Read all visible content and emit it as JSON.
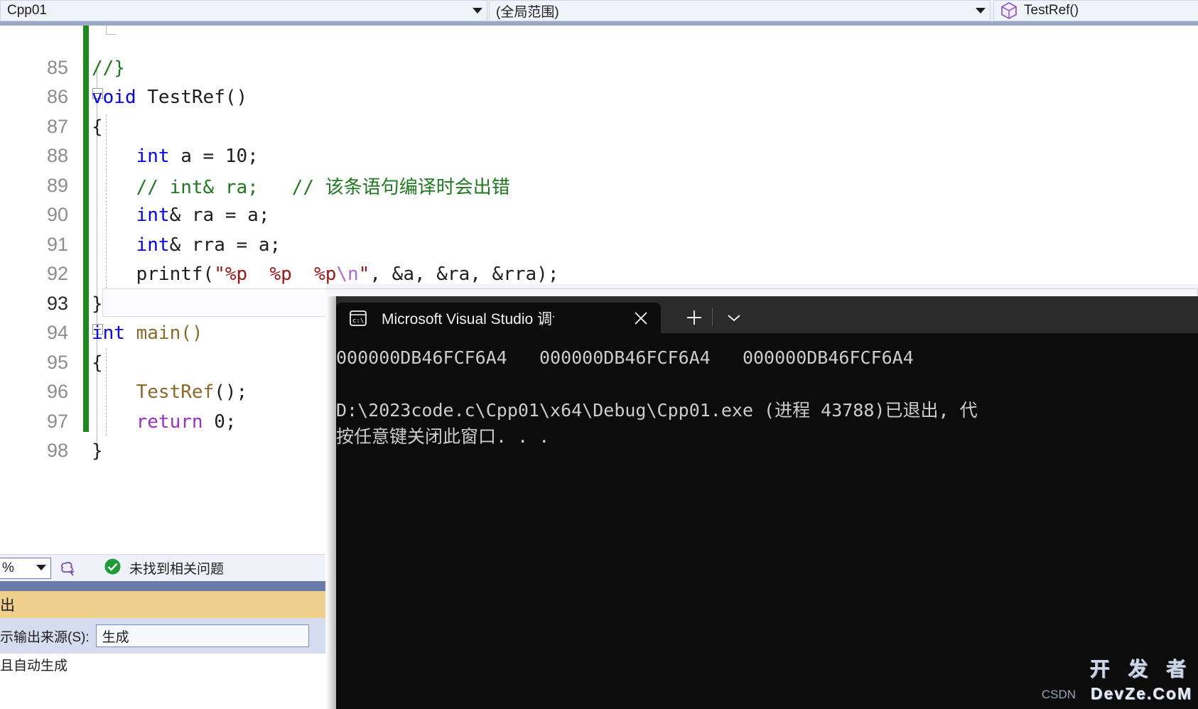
{
  "navbar": {
    "project_selector": "Cpp01",
    "scope_selector": "(全局范围)",
    "member_selector": "TestRef()",
    "member_icon": "cube-icon",
    "caret_icon": "chevron-down-icon"
  },
  "editor": {
    "lines": [
      {
        "number": "85",
        "active": false
      },
      {
        "number": "86",
        "active": false
      },
      {
        "number": "87",
        "active": false
      },
      {
        "number": "88",
        "active": false
      },
      {
        "number": "89",
        "active": false
      },
      {
        "number": "90",
        "active": false
      },
      {
        "number": "91",
        "active": false
      },
      {
        "number": "92",
        "active": false
      },
      {
        "number": "93",
        "active": true
      },
      {
        "number": "94",
        "active": false
      },
      {
        "number": "95",
        "active": false
      },
      {
        "number": "96",
        "active": false
      },
      {
        "number": "97",
        "active": false
      },
      {
        "number": "98",
        "active": false
      }
    ],
    "code": {
      "l85_comment": "//}",
      "l86_kw": "void",
      "l86_rest": " TestRef()",
      "l87": "{",
      "l88_kw": "int",
      "l88_rest": " a = 10;",
      "l89_comment": "// int& ra;   // 该条语句编译时会出错",
      "l90_kw": "int",
      "l90_rest": "& ra = a;",
      "l91_kw": "int",
      "l91_rest": "& rra = a;",
      "l92_a": "printf(",
      "l92_str": "\"%p  %p  %p",
      "l92_esc": "\\n",
      "l92_str2": "\"",
      "l92_b": ", &a, &ra, &rra);",
      "l93": "}",
      "l94_kw": "int",
      "l94_fn": " main()",
      "l95": "{",
      "l96_fn": "TestRef",
      "l96_rest": "();",
      "l97_ctl": "return",
      "l97_rest": " 0;",
      "l98": "}"
    }
  },
  "status_bar": {
    "zoom_level": "%",
    "brain_icon": "insights-icon",
    "ok_icon": "check-circle-icon",
    "problem_text": "未找到相关问题"
  },
  "output_panel": {
    "tab_label": "出",
    "source_label": "示输出来源(S):",
    "source_value": "生成",
    "first_row": "且自动生成"
  },
  "console": {
    "tab_title": "Microsoft Visual Studio 调试控",
    "tab_icon": "console-icon",
    "close_icon": "close-icon",
    "new_tab_icon": "plus-icon",
    "tab_menu_icon": "chevron-down-icon",
    "output_line_1": "000000DB46FCF6A4   000000DB46FCF6A4   000000DB46FCF6A4",
    "output_line_2": "",
    "output_line_3": "D:\\2023code.c\\Cpp01\\x64\\Debug\\Cpp01.exe (进程 43788)已退出, 代",
    "output_line_4": "按任意键关闭此窗口. . ."
  },
  "watermark": {
    "top_text": "开 发 者",
    "bottom_text": "DevZe.CoM",
    "csdn_text": "CSDN"
  },
  "colors": {
    "keyword": "#0000ff",
    "comment": "#1f7a1f",
    "string": "#a31515",
    "escape": "#b06ad6",
    "function": "#8b6a28",
    "control": "#9b30c9",
    "change_bar": "#1e8a1e",
    "console_bg": "#0c0c0c",
    "output_tab": "#eecf8b",
    "splitter": "#6b7ba8"
  }
}
